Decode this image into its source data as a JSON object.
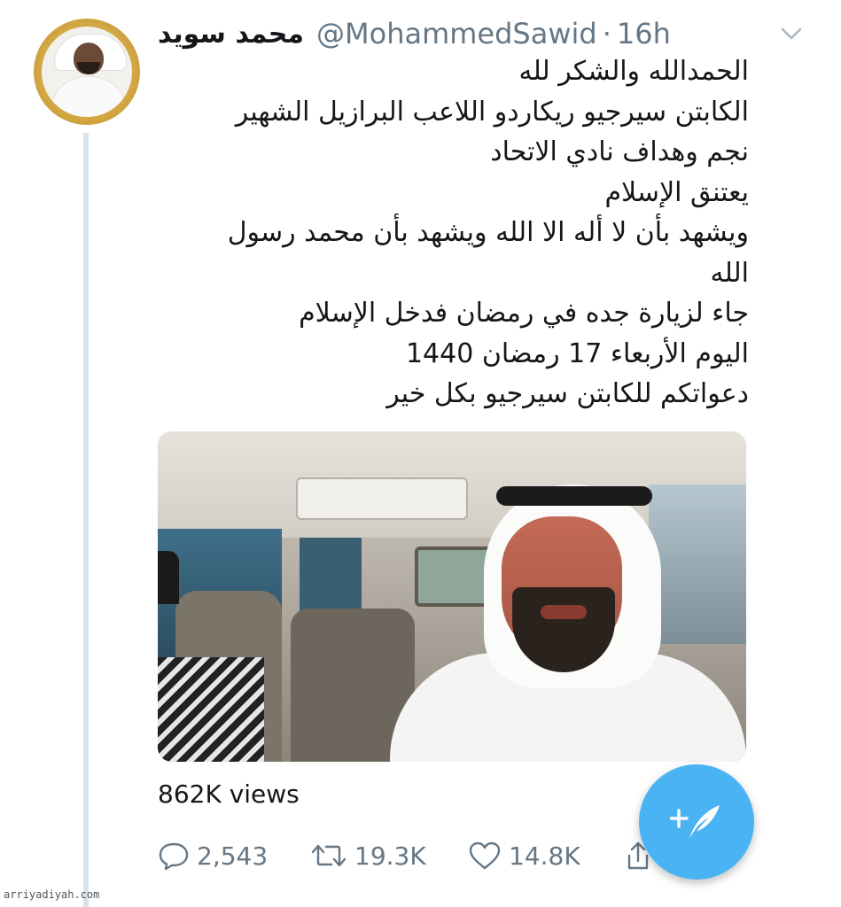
{
  "tweet": {
    "display_name": "محمد سويد",
    "handle": "@MohammedSawid",
    "separator": "·",
    "time": "16h",
    "lines": [
      "الحمدالله والشكر لله",
      "الكابتن سيرجيو ريكاردو اللاعب البرازيل الشهير",
      "نجم وهداف نادي الاتحاد",
      "يعتنق الإسلام",
      "ويشهد بأن لا أله الا الله ويشهد بأن محمد رسول",
      "الله",
      "جاء لزيارة جده في رمضان فدخل الإسلام",
      "اليوم الأربعاء 17 رمضان 1440",
      "دعواتكم للكابتن سيرجيو بكل خير"
    ],
    "views": "862K views",
    "replies": "2,543",
    "retweets": "19.3K",
    "likes": "14.8K"
  },
  "icons": {
    "chevron": "chevron-down-icon",
    "reply": "reply-icon",
    "retweet": "retweet-icon",
    "like": "heart-icon",
    "share": "share-icon",
    "compose": "compose-tweet-icon"
  },
  "colors": {
    "accent": "#4ab3f4",
    "muted": "#657786",
    "thread_line": "#d9e3ea"
  },
  "watermark": "arriyadiyah.com"
}
